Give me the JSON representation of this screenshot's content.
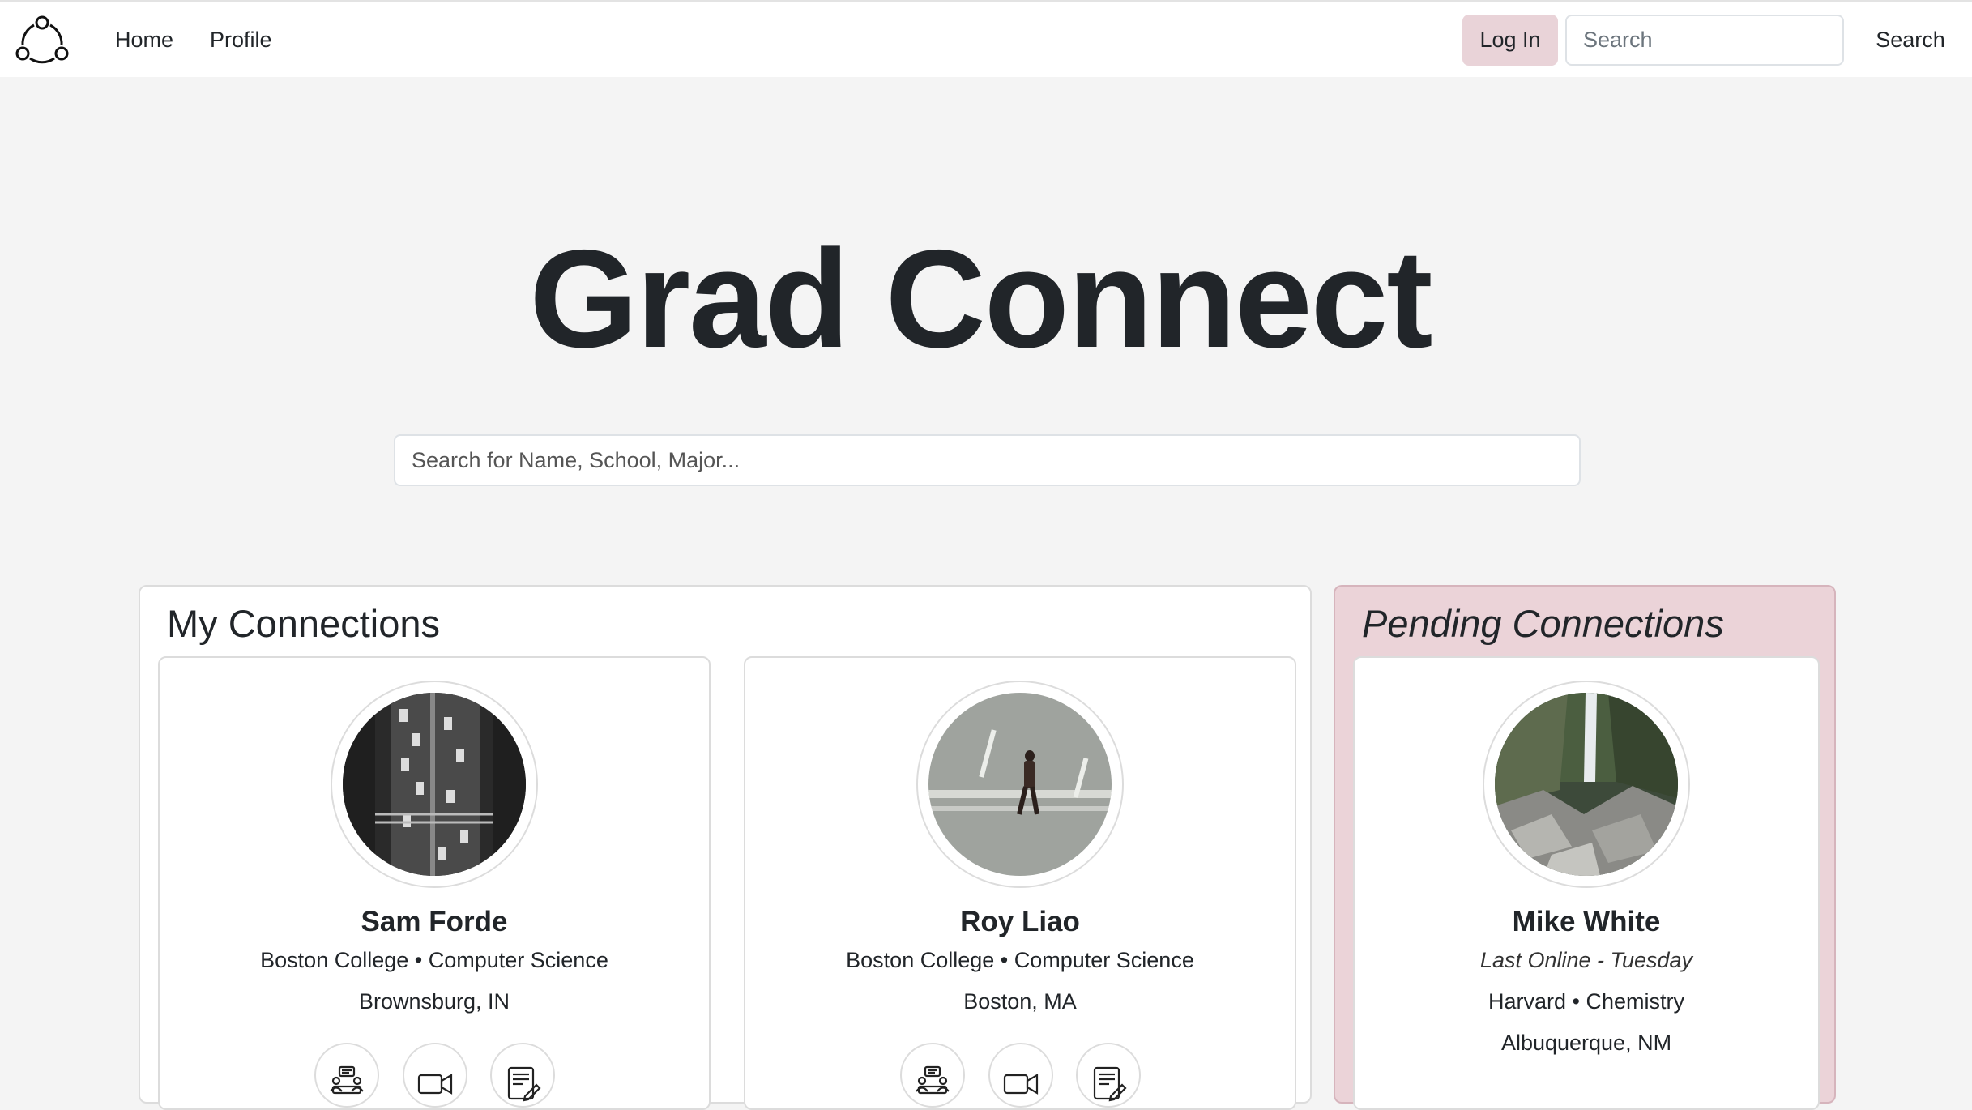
{
  "navbar": {
    "logo_icon": "three-dots-connected-logo",
    "links": [
      {
        "label": "Home"
      },
      {
        "label": "Profile"
      }
    ],
    "login_label": "Log In",
    "search_placeholder": "Search",
    "search_button_label": "Search"
  },
  "hero": {
    "title": "Grad Connect",
    "search_placeholder": "Search for Name, School, Major..."
  },
  "connections": {
    "title": "My Connections",
    "cards": [
      {
        "name": "Sam Forde",
        "school_major": "Boston College • Computer Science",
        "location": "Brownsburg, IN",
        "photo": "aerial city street with cars",
        "actions": [
          "chat-people-icon",
          "video-camera-icon",
          "notes-edit-icon"
        ]
      },
      {
        "name": "Roy Liao",
        "school_major": "Boston College • Computer Science",
        "location": "Boston, MA",
        "photo": "person walking on road",
        "actions": [
          "chat-people-icon",
          "video-camera-icon",
          "notes-edit-icon"
        ]
      }
    ]
  },
  "pending": {
    "title": "Pending Connections",
    "cards": [
      {
        "name": "Mike White",
        "last_online": "Last Online - Tuesday",
        "school_major": "Harvard • Chemistry",
        "location": "Albuquerque, NM",
        "photo": "waterfall over rocks"
      }
    ]
  },
  "colors": {
    "page_bg": "#f4f4f4",
    "accent_pink": "#ebd3d8",
    "login_bg": "#e9d3d8",
    "text": "#212529"
  }
}
